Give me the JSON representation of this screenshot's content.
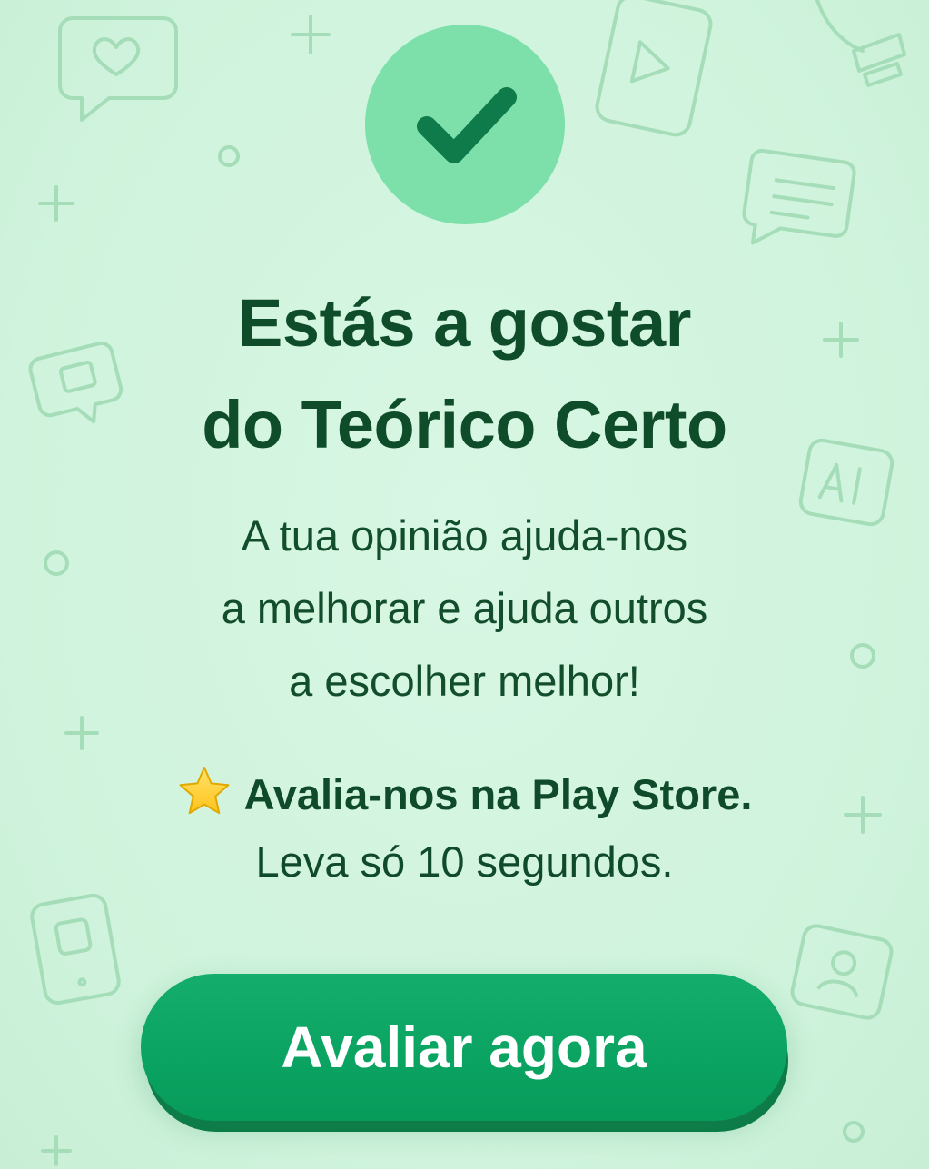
{
  "prompt": {
    "title_lines": [
      "Estás a gostar",
      "do Teórico Certo"
    ],
    "message_lines": [
      "A tua opinião ajuda-nos",
      "a melhorar e ajuda outros",
      "a escolher melhor!"
    ],
    "rate_title": "Avalia-nos na Play Store.",
    "rate_subtitle": "Leva só 10 segundos.",
    "cta_label": "Avaliar agora"
  },
  "icons": {
    "badge": "checkmark-icon",
    "rate": "star-icon"
  },
  "colors": {
    "background": "#d3f5e0",
    "badge": "#7de0ab",
    "checkmark": "#0f7a4a",
    "heading_text": "#0f4d2a",
    "button": "#0aa361",
    "button_text": "#ffffff",
    "star": "#ffd43b"
  }
}
